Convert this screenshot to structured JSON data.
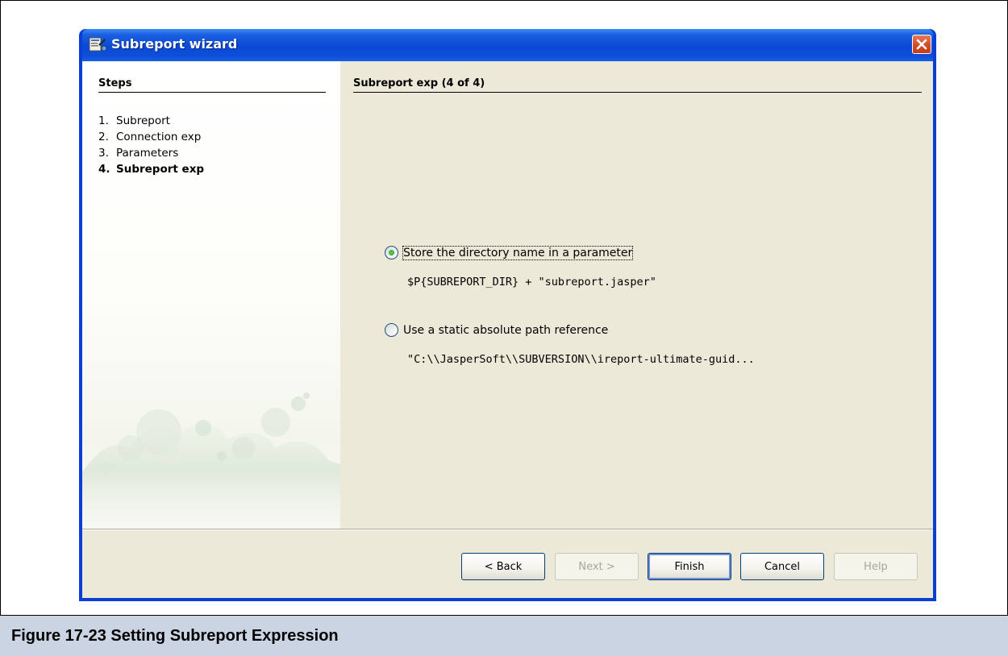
{
  "window": {
    "title": "Subreport wizard",
    "close_icon": "close-x-icon",
    "app_icon": "report-wizard-icon"
  },
  "steps": {
    "heading": "Steps",
    "items": [
      {
        "num": "1.",
        "label": "Subreport",
        "current": false
      },
      {
        "num": "2.",
        "label": "Connection exp",
        "current": false
      },
      {
        "num": "3.",
        "label": "Parameters",
        "current": false
      },
      {
        "num": "4.",
        "label": "Subreport exp",
        "current": true
      }
    ]
  },
  "content": {
    "heading": "Subreport exp (4 of 4)",
    "options": [
      {
        "label": "Store the directory name in a parameter",
        "expression": "$P{SUBREPORT_DIR} + \"subreport.jasper\"",
        "selected": true
      },
      {
        "label": "Use a static absolute path reference",
        "expression": "\"C:\\\\JasperSoft\\\\SUBVERSION\\\\ireport-ultimate-guid...",
        "selected": false
      }
    ]
  },
  "buttons": {
    "back": "< Back",
    "next": "Next >",
    "finish": "Finish",
    "cancel": "Cancel",
    "help": "Help"
  },
  "caption": "Figure 17-23  Setting Subreport Expression",
  "colors": {
    "titlebar": "#0a49d6",
    "dialog_bg": "#ece9d8",
    "close_button": "#cf4a22",
    "caption_bg": "#cbd4e2",
    "radio_selected": "#2e9a2e"
  }
}
